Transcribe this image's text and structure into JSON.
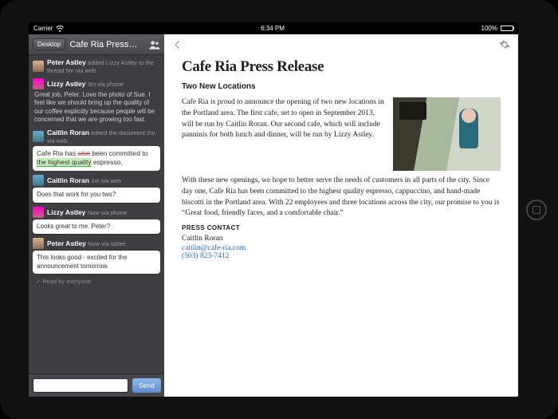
{
  "status": {
    "carrier": "Carrier",
    "time": "6:34 PM",
    "battery": "100%"
  },
  "sidebar": {
    "badge": "Desktop",
    "title": "Cafe Ria Press…",
    "thread": [
      {
        "avatar": "av1",
        "name": "Peter Astley",
        "meta": " added Lizzy Astley to the thread 5m via web",
        "type": "sys"
      },
      {
        "avatar": "av2",
        "name": "Lizzy Astley",
        "meta": "3m via phone",
        "type": "dark",
        "text": "Great job, Peter. Love the photo of Sue. I feel like we should bring up the quality of our coffee explicitly because people will be concerned that we are growing too fast."
      },
      {
        "avatar": "av3",
        "name": "Caitlin Roran",
        "meta": " edited the document 2m via web",
        "type": "diff",
        "diff_before": "Cafe Ria has ",
        "diff_del": "also",
        "diff_mid": " been committed to ",
        "diff_ins": "the highest quality",
        "diff_after": " espresso,"
      },
      {
        "avatar": "av3",
        "name": "Caitlin Roran",
        "meta": "1m via web",
        "type": "bubble",
        "text": "Does that work for you two?"
      },
      {
        "avatar": "av2",
        "name": "Lizzy Astley",
        "meta": "Now via phone",
        "type": "bubble",
        "text": "Looks great to me. Peter?"
      },
      {
        "avatar": "av1",
        "name": "Peter Astley",
        "meta": "Now via tablet",
        "type": "bubble",
        "text": "This looks good - excited for the announcement tomorrow."
      }
    ],
    "read_receipt": "✓ Read by everyone",
    "composer_placeholder": "",
    "send_label": "Send"
  },
  "document": {
    "title": "Cafe Ria Press Release",
    "subtitle": "Two New Locations",
    "p1": "Cafe Ria is proud to announce the opening of two new locations in the Portland area. The first cafe, set to open in September 2013, will be run by Caitlin Roran. Our second cafe, which will include panninis for both lunch and dinner, will be run by Lizzy Astley.",
    "p2": "With these new openings, we hope to better serve the needs of customers in all parts of the city. Since day one, Cafe Ria has been committed to the highest quality espresso, cappuccino, and hand-made biscotti in the Portland area. With 22 employees and three locations across the city, our promise to you is “Great food, friendly faces, and a comfortable chair.”",
    "contact_label": "PRESS CONTACT",
    "contact_name": "Caitlin Roran",
    "contact_email": "caitlin@cafe-ria.com",
    "contact_phone": "(503) 823-7412"
  }
}
